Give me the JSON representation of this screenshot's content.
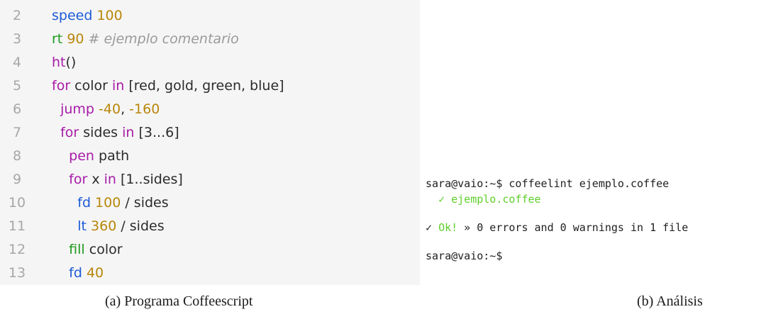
{
  "code_panel": {
    "lines": [
      {
        "num": "2",
        "tokens": [
          {
            "t": "speed",
            "c": "blue"
          },
          {
            "t": " ",
            "c": "plain"
          },
          {
            "t": "100",
            "c": "num"
          }
        ]
      },
      {
        "num": "3",
        "tokens": [
          {
            "t": "rt",
            "c": "green"
          },
          {
            "t": " ",
            "c": "plain"
          },
          {
            "t": "90",
            "c": "num"
          },
          {
            "t": " # ejemplo comentario",
            "c": "cmt"
          }
        ]
      },
      {
        "num": "4",
        "tokens": [
          {
            "t": "ht",
            "c": "purple"
          },
          {
            "t": "()",
            "c": "plain"
          }
        ]
      },
      {
        "num": "5",
        "tokens": [
          {
            "t": "for",
            "c": "purple"
          },
          {
            "t": " color ",
            "c": "plain"
          },
          {
            "t": "in",
            "c": "purple"
          },
          {
            "t": " [red, gold, green, blue]",
            "c": "plain"
          }
        ]
      },
      {
        "num": "6",
        "tokens": [
          {
            "t": "  ",
            "c": "plain"
          },
          {
            "t": "jump",
            "c": "purple"
          },
          {
            "t": " ",
            "c": "plain"
          },
          {
            "t": "-40",
            "c": "num"
          },
          {
            "t": ", ",
            "c": "plain"
          },
          {
            "t": "-160",
            "c": "num"
          }
        ]
      },
      {
        "num": "7",
        "tokens": [
          {
            "t": "  ",
            "c": "plain"
          },
          {
            "t": "for",
            "c": "purple"
          },
          {
            "t": " sides ",
            "c": "plain"
          },
          {
            "t": "in",
            "c": "purple"
          },
          {
            "t": " [3...6]",
            "c": "plain"
          }
        ]
      },
      {
        "num": "8",
        "tokens": [
          {
            "t": "    ",
            "c": "plain"
          },
          {
            "t": "pen",
            "c": "purple"
          },
          {
            "t": " path",
            "c": "plain"
          }
        ]
      },
      {
        "num": "9",
        "tokens": [
          {
            "t": "    ",
            "c": "plain"
          },
          {
            "t": "for",
            "c": "purple"
          },
          {
            "t": " x ",
            "c": "plain"
          },
          {
            "t": "in",
            "c": "purple"
          },
          {
            "t": " [1..sides]",
            "c": "plain"
          }
        ]
      },
      {
        "num": "10",
        "tokens": [
          {
            "t": "      ",
            "c": "plain"
          },
          {
            "t": "fd",
            "c": "blue"
          },
          {
            "t": " ",
            "c": "plain"
          },
          {
            "t": "100",
            "c": "num"
          },
          {
            "t": " / sides",
            "c": "plain"
          }
        ]
      },
      {
        "num": "11",
        "tokens": [
          {
            "t": "      ",
            "c": "plain"
          },
          {
            "t": "lt",
            "c": "blue"
          },
          {
            "t": " ",
            "c": "plain"
          },
          {
            "t": "360",
            "c": "num"
          },
          {
            "t": " / sides",
            "c": "plain"
          }
        ]
      },
      {
        "num": "12",
        "tokens": [
          {
            "t": "    ",
            "c": "plain"
          },
          {
            "t": "fill",
            "c": "green"
          },
          {
            "t": " color",
            "c": "plain"
          }
        ]
      },
      {
        "num": "13",
        "tokens": [
          {
            "t": "    ",
            "c": "plain"
          },
          {
            "t": "fd",
            "c": "blue"
          },
          {
            "t": " ",
            "c": "plain"
          },
          {
            "t": "40",
            "c": "num"
          }
        ]
      }
    ],
    "colors": {
      "background": "#f5f5f5",
      "line_number": "#a7a7a7",
      "blue": "#1c5bd6",
      "green": "#1f9a1f",
      "purple": "#a81ba8",
      "num": "#b8860b",
      "cmt": "#9a9a9a"
    }
  },
  "terminal": {
    "command_line": "sara@vaio:~$ coffeelint ejemplo.coffee",
    "file_check_mark": "✓",
    "file_name": "ejemplo.coffee",
    "summary_check_mark": "✓",
    "summary_ok": "Ok!",
    "summary_rest": " » 0 errors and 0 warnings in 1 file",
    "prompt": "sara@vaio:~$",
    "colors": {
      "ok_green": "#5fcf2a",
      "text": "#1f1f1f"
    }
  },
  "captions": {
    "left": "(a) Programa Coffeescript",
    "right": "(b) Análisis"
  }
}
